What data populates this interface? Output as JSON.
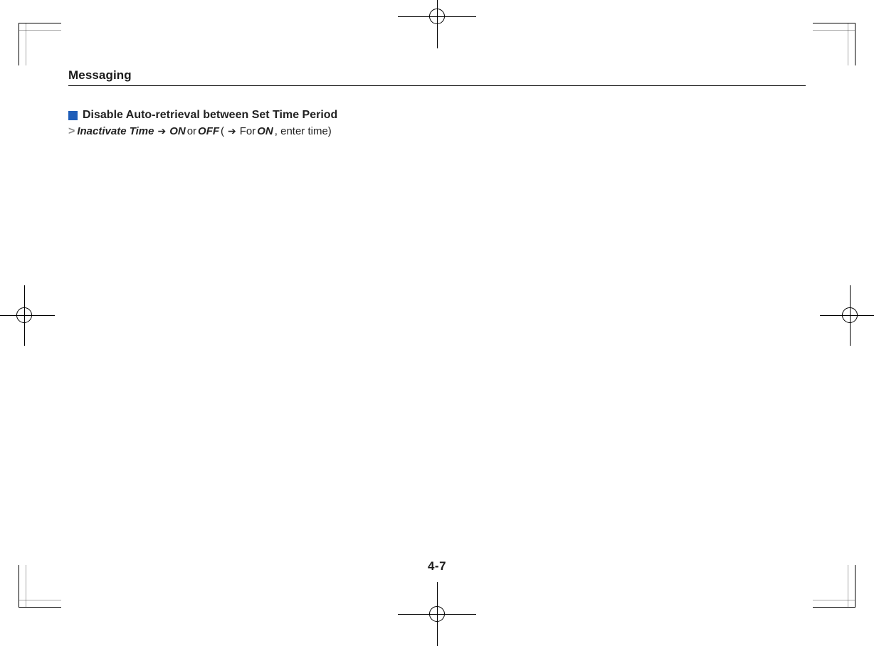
{
  "header": {
    "title": "Messaging"
  },
  "entry": {
    "title": "Disable Auto-retrieval between Set Time Period",
    "instruction": {
      "inactivate_time": "Inactivate Time",
      "on": "ON",
      "or": " or ",
      "off": "OFF",
      "open_paren": " (",
      "for_label": " For ",
      "on2": "ON",
      "enter_time": " , enter time)"
    }
  },
  "page_number": "4-7"
}
